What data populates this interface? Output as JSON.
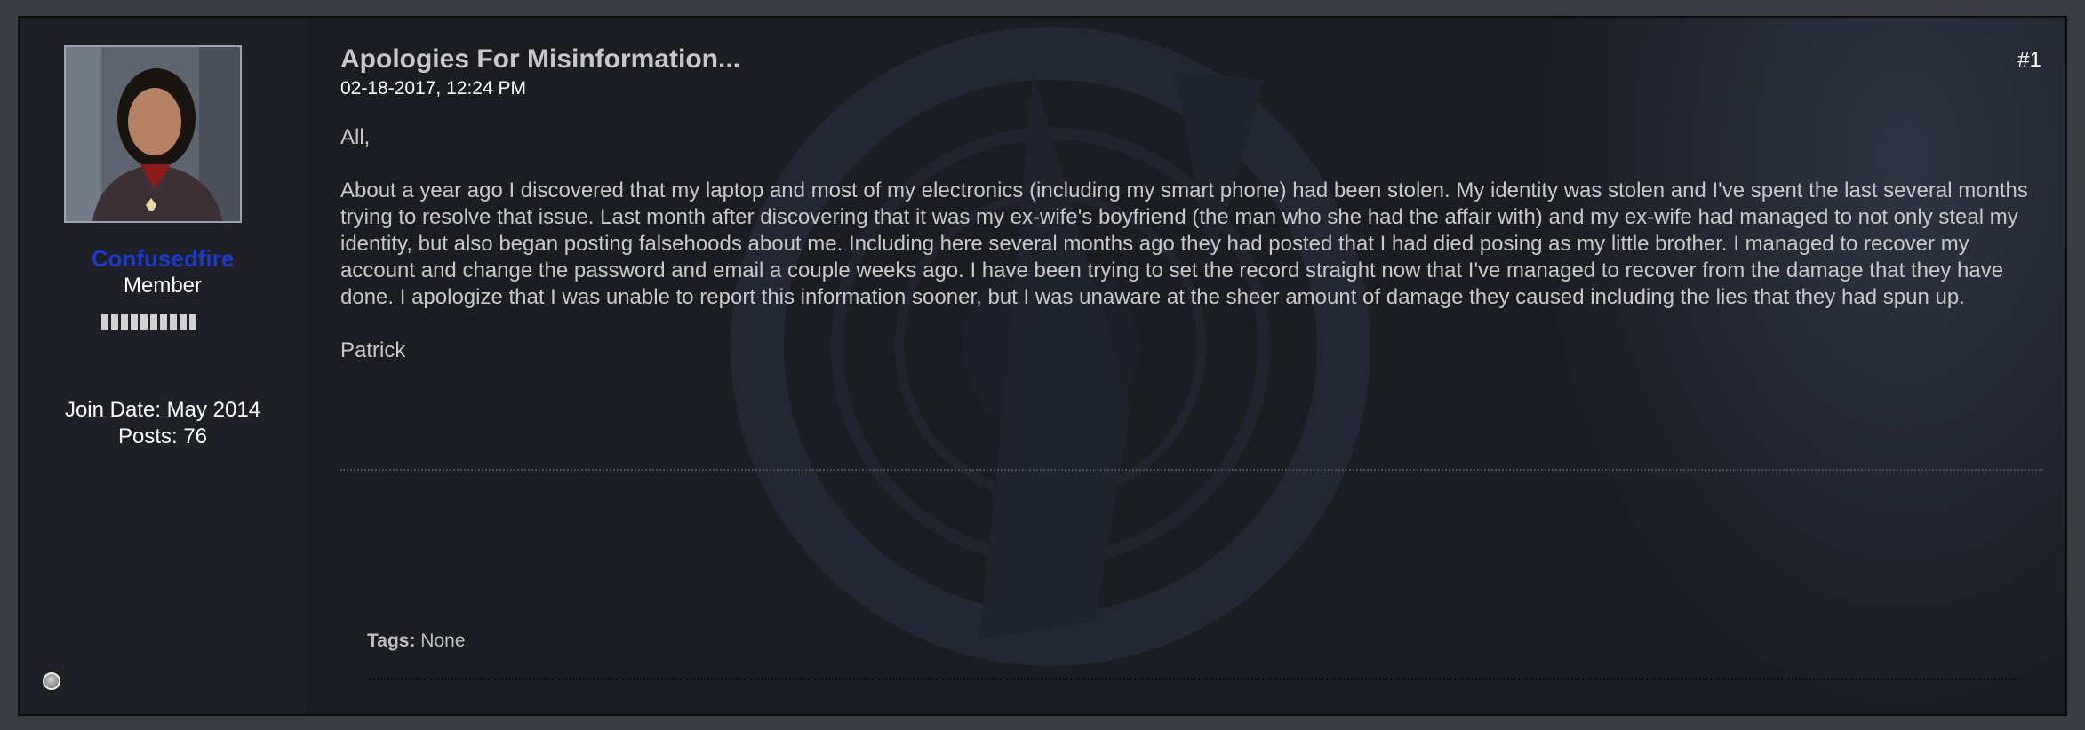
{
  "post": {
    "title": "Apologies For Misinformation...",
    "date": "02-18-2017, 12:24 PM",
    "number": "#1",
    "paragraphs": [
      "All,",
      "About a year ago I discovered that my laptop and most of my electronics (including my smart phone) had been stolen. My identity was stolen and I've spent the last several months trying to resolve that issue. Last month after discovering that it was my ex-wife's boyfriend (the man who she had the affair with) and my ex-wife had managed to not only steal my identity, but also began posting falsehoods about me. Including here several months ago they had posted that I had died posing as my little brother. I managed to recover my account and change the password and email a couple weeks ago. I have been trying to set the record straight now that I've managed to recover from the damage that they have done. I apologize that I was unable to report this information sooner, but I was unaware at the sheer amount of damage they caused including the lies that they had spun up.",
      "Patrick"
    ],
    "tags_label": "Tags:",
    "tags_value": "None"
  },
  "user": {
    "name": "Confusedfire",
    "title": "Member",
    "join_date": "Join Date: May 2014",
    "posts": "Posts: 76",
    "reputation_pips": 10,
    "status": "offline"
  },
  "colors": {
    "username": "#1c39c9",
    "panel": "#1b1d22",
    "text": "#c8c8c8"
  }
}
